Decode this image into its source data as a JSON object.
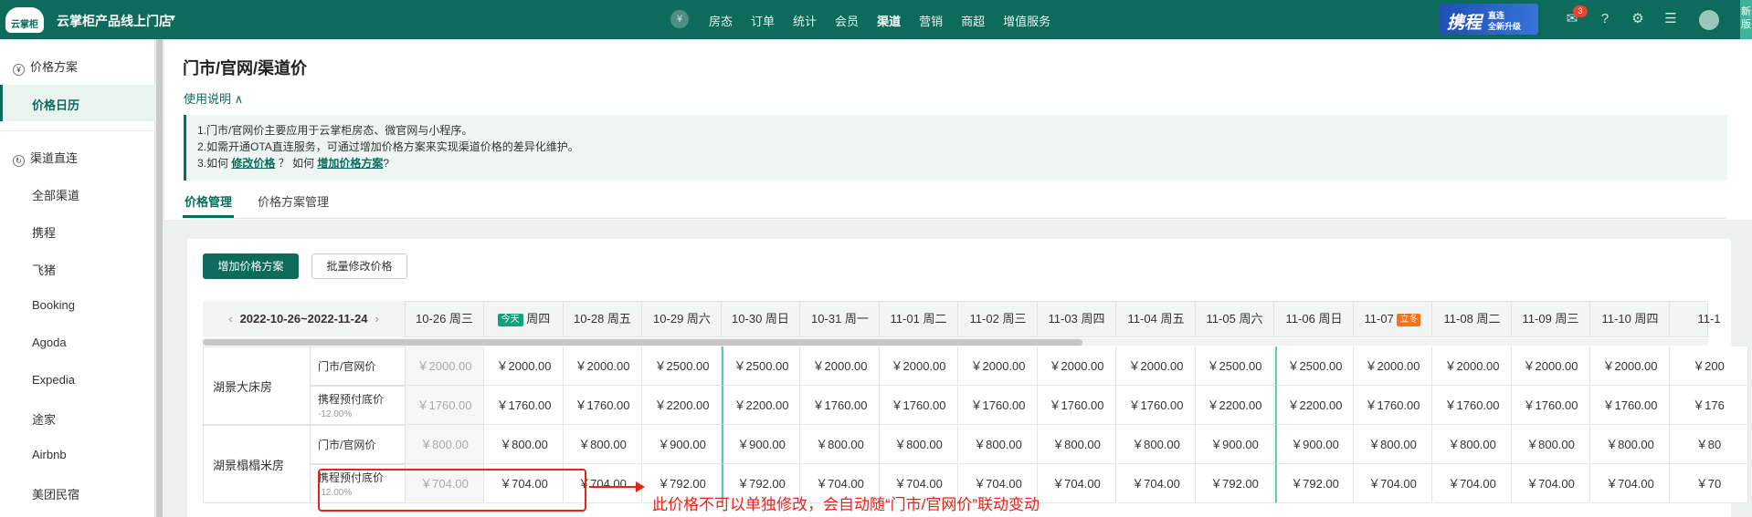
{
  "topbar": {
    "logo": "云掌柜",
    "shop_name": "云掌柜产品线上门店",
    "shop_caret": "▼",
    "nav": [
      "房态",
      "订单",
      "统计",
      "会员",
      "渠道",
      "营销",
      "商超",
      "增值服务"
    ],
    "active_nav": "渠道",
    "promo": {
      "brand": "携程",
      "line1": "直连",
      "line2": "全新升级"
    },
    "message_count": "3",
    "new_version": "新版"
  },
  "sidebar": {
    "group1": "价格方案",
    "active_item": "价格日历",
    "group2": "渠道直连",
    "channels": [
      "全部渠道",
      "携程",
      "飞猪",
      "Booking",
      "Agoda",
      "Expedia",
      "途家",
      "Airbnb",
      "美团民宿"
    ]
  },
  "main": {
    "title": "门市/官网/渠道价",
    "usage_toggle": "使用说明 ∧",
    "notes": {
      "line1": "1.门市/官网价主要应用于云掌柜房态、微官网与小程序。",
      "line2": "2.如需开通OTA直连服务，可通过增加价格方案来实现渠道价格的差异化维护。",
      "line3_pre": "3.如何",
      "line3_link1": "修改价格",
      "line3_mid": "？ 如何",
      "line3_link2": "增加价格方案",
      "line3_end": "?"
    },
    "tabs": [
      "价格管理",
      "价格方案管理"
    ],
    "buttons": {
      "add_plan": "增加价格方案",
      "batch_edit": "批量修改价格"
    }
  },
  "table": {
    "range": "2022-10-26~2022-11-24",
    "today_badge": "今天",
    "lidong_badge": "立冬",
    "dates": [
      {
        "date": "10-26",
        "dow": "周三"
      },
      {
        "date": "",
        "dow": "周四",
        "today": true
      },
      {
        "date": "10-28",
        "dow": "周五"
      },
      {
        "date": "10-29",
        "dow": "周六"
      },
      {
        "date": "10-30",
        "dow": "周日"
      },
      {
        "date": "10-31",
        "dow": "周一"
      },
      {
        "date": "11-01",
        "dow": "周二"
      },
      {
        "date": "11-02",
        "dow": "周三"
      },
      {
        "date": "11-03",
        "dow": "周四"
      },
      {
        "date": "11-04",
        "dow": "周五"
      },
      {
        "date": "11-05",
        "dow": "周六"
      },
      {
        "date": "11-06",
        "dow": "周日"
      },
      {
        "date": "11-07",
        "dow": "",
        "lidong": true
      },
      {
        "date": "11-08",
        "dow": "周二"
      },
      {
        "date": "11-09",
        "dow": "周三"
      },
      {
        "date": "11-10",
        "dow": "周四"
      },
      {
        "date": "11-1",
        "dow": ""
      }
    ],
    "rooms": [
      {
        "name": "湖景大床房",
        "rows": [
          {
            "label": "门市/官网价",
            "sub": "",
            "prices": [
              "￥2000.00",
              "￥2000.00",
              "￥2000.00",
              "￥2500.00",
              "￥2500.00",
              "￥2000.00",
              "￥2000.00",
              "￥2000.00",
              "￥2000.00",
              "￥2000.00",
              "￥2500.00",
              "￥2500.00",
              "￥2000.00",
              "￥2000.00",
              "￥2000.00",
              "￥2000.00",
              "￥200"
            ]
          },
          {
            "label": "携程预付底价",
            "sub": "-12.00%",
            "prices": [
              "￥1760.00",
              "￥1760.00",
              "￥1760.00",
              "￥2200.00",
              "￥2200.00",
              "￥1760.00",
              "￥1760.00",
              "￥1760.00",
              "￥1760.00",
              "￥1760.00",
              "￥2200.00",
              "￥2200.00",
              "￥1760.00",
              "￥1760.00",
              "￥1760.00",
              "￥1760.00",
              "￥176"
            ]
          }
        ]
      },
      {
        "name": "湖景榻榻米房",
        "rows": [
          {
            "label": "门市/官网价",
            "sub": "",
            "prices": [
              "￥800.00",
              "￥800.00",
              "￥800.00",
              "￥900.00",
              "￥900.00",
              "￥800.00",
              "￥800.00",
              "￥800.00",
              "￥800.00",
              "￥800.00",
              "￥900.00",
              "￥900.00",
              "￥800.00",
              "￥800.00",
              "￥800.00",
              "￥800.00",
              "￥80"
            ]
          },
          {
            "label": "携程预付底价",
            "sub": "-12.00%",
            "prices": [
              "￥704.00",
              "￥704.00",
              "￥704.00",
              "￥792.00",
              "￥792.00",
              "￥704.00",
              "￥704.00",
              "￥704.00",
              "￥704.00",
              "￥704.00",
              "￥792.00",
              "￥792.00",
              "￥704.00",
              "￥704.00",
              "￥704.00",
              "￥704.00",
              "￥70"
            ]
          }
        ]
      }
    ]
  },
  "annotation": "此价格不可以单独修改，会自动随“门市/官网价”联动变动",
  "colors": {
    "brand": "#0c6b5b",
    "annotation": "#e8231c",
    "today": "#11a17f",
    "lidong": "#ff6d1a"
  }
}
